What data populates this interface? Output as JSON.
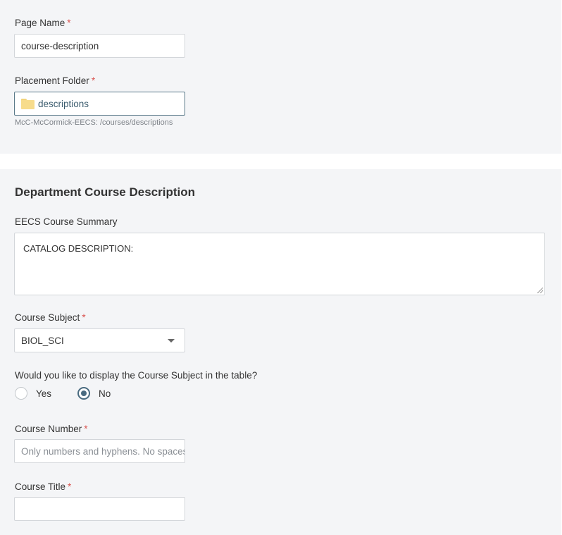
{
  "page_name": {
    "label": "Page Name",
    "required_marker": "*",
    "value": "course-description"
  },
  "placement_folder": {
    "label": "Placement Folder",
    "required_marker": "*",
    "value": "descriptions",
    "path_hint": "McC-McCormick-EECS: /courses/descriptions"
  },
  "section": {
    "title": "Department Course Description"
  },
  "course_summary": {
    "label": "EECS Course Summary",
    "value": "CATALOG DESCRIPTION:"
  },
  "course_subject": {
    "label": "Course Subject",
    "required_marker": "*",
    "selected": "BIOL_SCI"
  },
  "display_subject": {
    "question": "Would you like to display the Course Subject in the table?",
    "options": [
      {
        "label": "Yes",
        "checked": false
      },
      {
        "label": "No",
        "checked": true
      }
    ]
  },
  "course_number": {
    "label": "Course Number",
    "required_marker": "*",
    "placeholder": "Only numbers and hyphens. No spaces."
  },
  "course_title": {
    "label": "Course Title",
    "required_marker": "*",
    "value": ""
  }
}
